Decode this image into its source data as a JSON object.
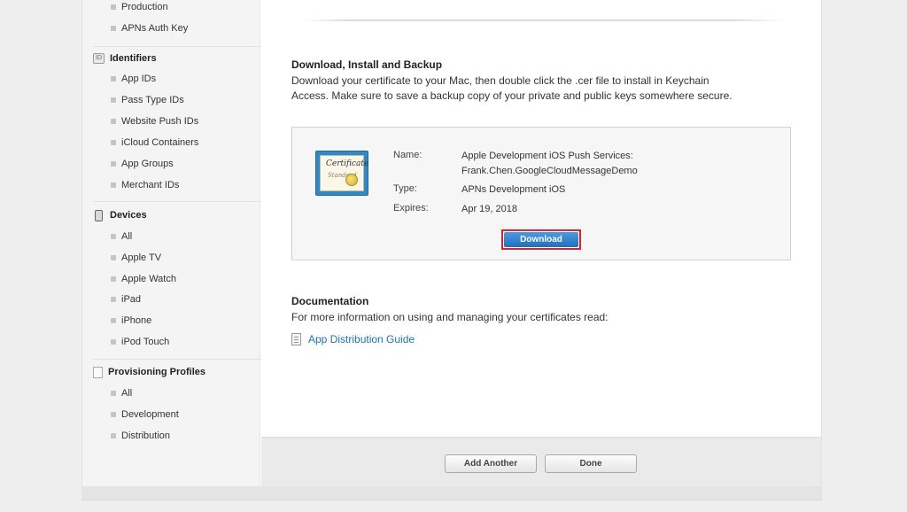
{
  "sidebar": {
    "top_items": [
      "Production",
      "APNs Auth Key"
    ],
    "identifiers": {
      "title": "Identifiers",
      "icon_text": "ID",
      "items": [
        "App IDs",
        "Pass Type IDs",
        "Website Push IDs",
        "iCloud Containers",
        "App Groups",
        "Merchant IDs"
      ]
    },
    "devices": {
      "title": "Devices",
      "items": [
        "All",
        "Apple TV",
        "Apple Watch",
        "iPad",
        "iPhone",
        "iPod Touch"
      ]
    },
    "provisioning": {
      "title": "Provisioning Profiles",
      "items": [
        "All",
        "Development",
        "Distribution"
      ]
    }
  },
  "main": {
    "download_section": {
      "title": "Download, Install and Backup",
      "line1": "Download your certificate to your Mac, then double click the .cer file to install in Keychain",
      "line2": "Access. Make sure to save a backup copy of your private and public keys somewhere secure."
    },
    "certificate": {
      "icon_word": "Certificate",
      "icon_sub": "Standard",
      "name_label": "Name:",
      "name_line1": "Apple Development iOS Push Services:",
      "name_line2": "Frank.Chen.GoogleCloudMessageDemo",
      "type_label": "Type:",
      "type_value": "APNs Development iOS",
      "expires_label": "Expires:",
      "expires_value": "Apr 19, 2018",
      "download_label": "Download"
    },
    "documentation": {
      "title": "Documentation",
      "text": "For more information on using and managing your certificates read:",
      "link": "App Distribution Guide"
    }
  },
  "footer": {
    "add_another_label": "Add Another",
    "done_label": "Done"
  },
  "colors": {
    "link": "#1a73c9",
    "download_button": "#1f6fc0",
    "highlight_border": "#d9232b"
  }
}
